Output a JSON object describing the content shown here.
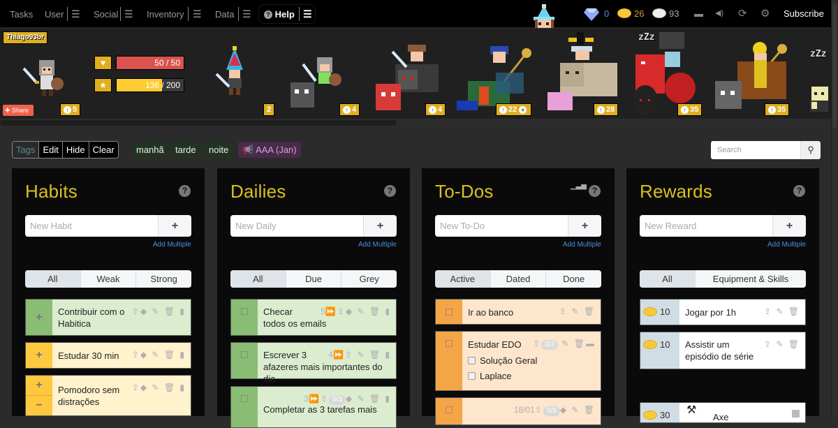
{
  "nav": {
    "items": [
      {
        "label": "Tasks"
      },
      {
        "label": "User"
      },
      {
        "label": "Social"
      },
      {
        "label": "Inventory"
      },
      {
        "label": "Data"
      },
      {
        "label": "Help"
      }
    ],
    "menu_glyph": "☰",
    "currency": {
      "gems": "0",
      "gold": "26",
      "silver": "93"
    },
    "icons": [
      "chat-icon",
      "sound-icon",
      "sync-icon",
      "settings-icon"
    ],
    "subscribe_label": "Subscribe"
  },
  "party": {
    "username": "Thiago93br",
    "health": {
      "label": "50 / 50",
      "value": 50,
      "max": 50,
      "color": "#d9534f"
    },
    "experience": {
      "label": "136 / 200",
      "value": 136,
      "max": 200,
      "color": "#ffcc33"
    },
    "share_label": "Share",
    "members": [
      {
        "level": "5"
      },
      {
        "level": "2"
      },
      {
        "level": "4"
      },
      {
        "level": "4"
      },
      {
        "level": "22"
      },
      {
        "level": "28"
      },
      {
        "level": "35"
      },
      {
        "level": "35"
      }
    ],
    "sleep_text": "zZz"
  },
  "filterbar": {
    "buttons": [
      "Tags",
      "Edit",
      "Hide",
      "Clear"
    ],
    "tags": [
      {
        "label": "manhã",
        "bg": "#223322",
        "fg": "#e8efe8"
      },
      {
        "label": "tarde",
        "bg": "#223322",
        "fg": "#e8efe8"
      },
      {
        "label": "noite",
        "bg": "#223322",
        "fg": "#e8efe8"
      },
      {
        "label": "AAA (Jan)",
        "bg": "#4a2a4a",
        "fg": "#c9a6d6"
      }
    ],
    "search_placeholder": "Search"
  },
  "columns": {
    "habits": {
      "title": "Habits",
      "placeholder": "New Habit",
      "add_multiple": "Add Multiple",
      "filters": [
        "All",
        "Weak",
        "Strong"
      ],
      "tasks": [
        {
          "text": "Contribuir com o Habitica",
          "color": "#8abd74",
          "bg": "#dbeccf"
        },
        {
          "text": "Estudar 30 min",
          "color": "#ffc93f",
          "bg": "#fff2cc"
        },
        {
          "text": "Pomodoro sem distrações",
          "color": "#ffc93f",
          "bg": "#fff2cc"
        }
      ]
    },
    "dailies": {
      "title": "Dailies",
      "placeholder": "New Daily",
      "add_multiple": "Add Multiple",
      "filters": [
        "All",
        "Due",
        "Grey"
      ],
      "tasks": [
        {
          "text_line1": "Checar",
          "text_line2": "todos os emails",
          "streak": "5",
          "color": "#8abd74",
          "bg": "#dbeccf"
        },
        {
          "text_line1": "Escrever 3",
          "text_line2": "afazeres mais importantes do dia",
          "streak": "4",
          "color": "#8abd74",
          "bg": "#dbeccf"
        },
        {
          "text_line1": "Completar as 3 tarefas mais",
          "streak": "3",
          "checklist": "0/3",
          "color": "#8abd74",
          "bg": "#dbeccf"
        }
      ]
    },
    "todos": {
      "title": "To-Dos",
      "placeholder": "New To-Do",
      "add_multiple": "Add Multiple",
      "filters": [
        "Active",
        "Dated",
        "Done"
      ],
      "tasks": [
        {
          "text": "Ir ao banco",
          "color": "#f4a547",
          "bg": "#fde6cc"
        },
        {
          "text": "Estudar EDO",
          "checklist": "0/2",
          "items": [
            "Solução Geral",
            "Laplace"
          ],
          "color": "#f4a547",
          "bg": "#fde6cc"
        },
        {
          "text": "",
          "date": "18/01",
          "checklist": "0/5",
          "color": "#f4a547",
          "bg": "#fde6cc"
        }
      ]
    },
    "rewards": {
      "title": "Rewards",
      "placeholder": "New Reward",
      "add_multiple": "Add Multiple",
      "filters": [
        "All",
        "Equipment & Skills"
      ],
      "items": [
        {
          "cost": "10",
          "text": "Jogar por 1h"
        },
        {
          "cost": "10",
          "text": "Assistir um episódio de série"
        },
        {
          "cost": "30",
          "text": "Axe"
        }
      ]
    }
  }
}
